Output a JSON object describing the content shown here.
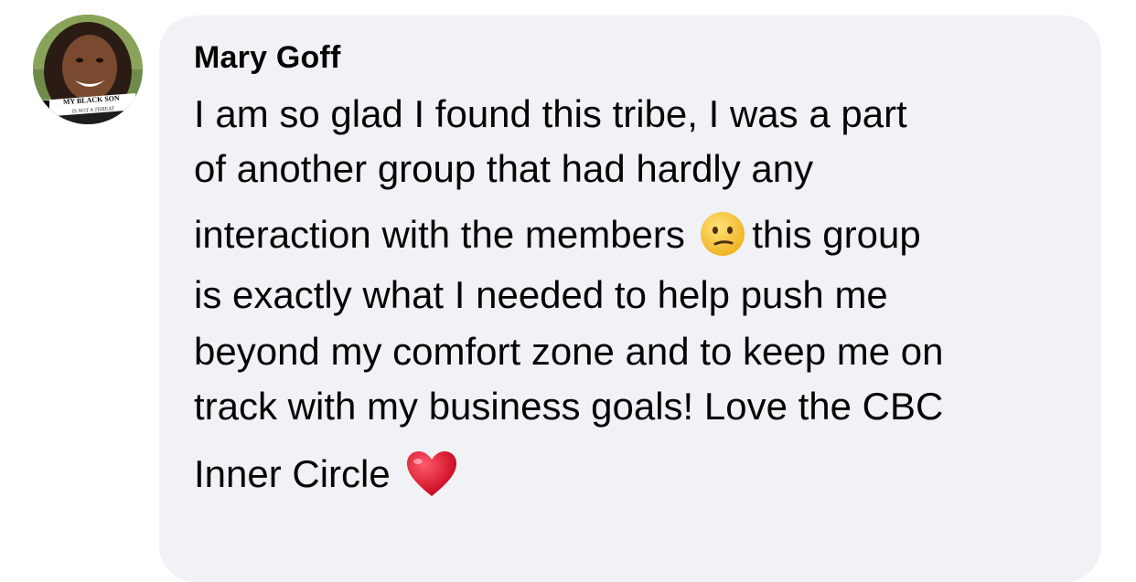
{
  "comment": {
    "author": "Mary Goff",
    "avatar_caption_line1": "MY BLACK SON",
    "avatar_caption_line2": "IS NOT A THREAT",
    "lines": [
      "I am so glad I found this tribe, I was a part",
      "of another group that had hardly any",
      "interaction with the members",
      "this group",
      "is exactly what I needed to help push me",
      "beyond my comfort zone and to keep me on",
      "track with my business goals! Love the CBC",
      "Inner Circle"
    ],
    "emoji": {
      "confused": "confused-face-icon",
      "heart": "red-heart-icon"
    }
  },
  "colors": {
    "bubble": "#f0f2f5",
    "text": "#050505",
    "heart": "#e0112b",
    "emoji_face": "#f7c33a"
  }
}
